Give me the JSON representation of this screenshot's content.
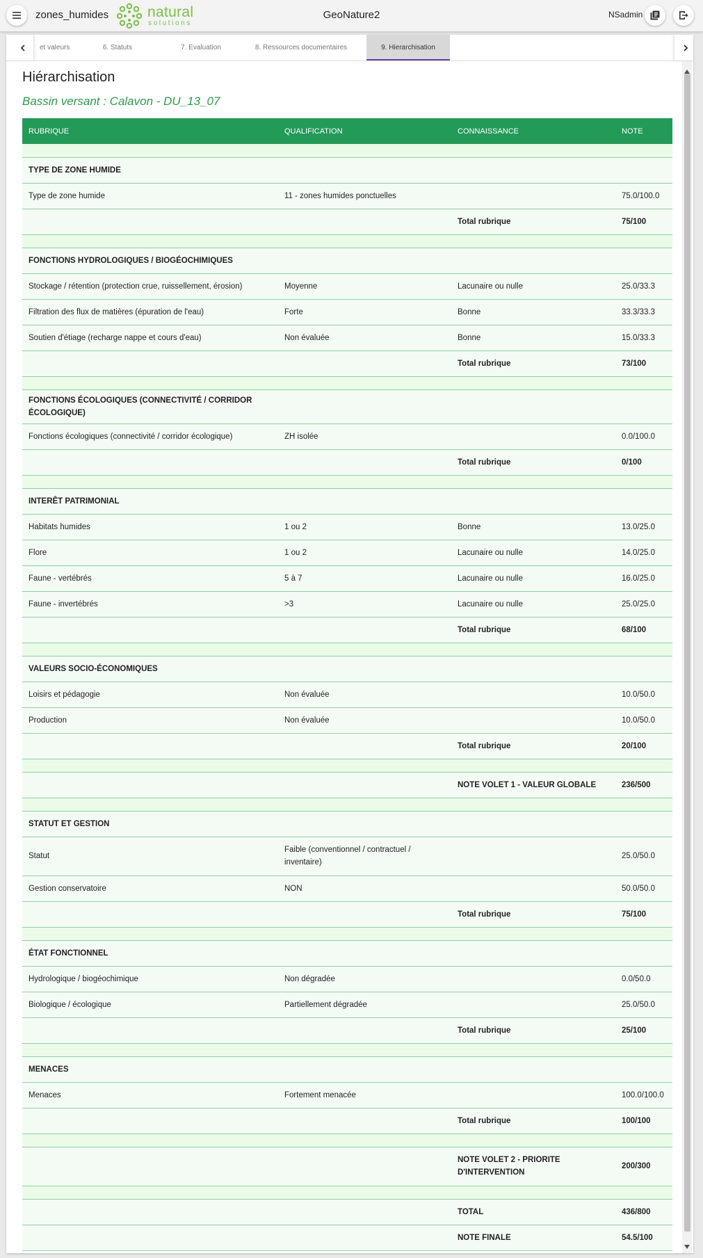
{
  "app": {
    "name": "zones_humides",
    "logo_word": "natural",
    "logo_sub": "solutions",
    "center_title": "GeoNature2",
    "user": "NSadmin"
  },
  "tabs": [
    {
      "label": "et valeurs",
      "active": false
    },
    {
      "label": "6. Statuts",
      "active": false
    },
    {
      "label": "7. Evaluation",
      "active": false
    },
    {
      "label": "8. Ressources documentaires",
      "active": false
    },
    {
      "label": "9. Hierarchisation",
      "active": true
    }
  ],
  "page": {
    "title": "Hiérarchisation",
    "subtitle": "Bassin versant : Calavon - DU_13_07"
  },
  "table": {
    "headers": [
      "RUBRIQUE",
      "QUALIFICATION",
      "CONNAISSANCE",
      "NOTE"
    ],
    "sections": [
      {
        "title": "TYPE DE ZONE HUMIDE",
        "rows": [
          {
            "rubrique": "Type de zone humide",
            "qualification": "11 - zones humides ponctuelles",
            "connaissance": "",
            "note": "75.0/100.0"
          }
        ],
        "total_label": "Total rubrique",
        "total": "75/100"
      },
      {
        "title": "FONCTIONS HYDROLOGIQUES / BIOGÉOCHIMIQUES",
        "rows": [
          {
            "rubrique": "Stockage / rétention (protection crue, ruissellement, érosion)",
            "qualification": "Moyenne",
            "connaissance": "Lacunaire ou nulle",
            "note": "25.0/33.3"
          },
          {
            "rubrique": "Filtration des flux de matières (épuration de l'eau)",
            "qualification": "Forte",
            "connaissance": "Bonne",
            "note": "33.3/33.3"
          },
          {
            "rubrique": "Soutien d'étiage (recharge nappe et cours d'eau)",
            "qualification": "Non évaluée",
            "connaissance": "Bonne",
            "note": "15.0/33.3"
          }
        ],
        "total_label": "Total rubrique",
        "total": "73/100"
      },
      {
        "title": "FONCTIONS ÉCOLOGIQUES (CONNECTIVITÉ / CORRIDOR ÉCOLOGIQUE)",
        "rows": [
          {
            "rubrique": "Fonctions écologiques (connectivité / corridor écologique)",
            "qualification": "ZH isolée",
            "connaissance": "",
            "note": "0.0/100.0"
          }
        ],
        "total_label": "Total rubrique",
        "total": "0/100"
      },
      {
        "title": "INTERÊT PATRIMONIAL",
        "rows": [
          {
            "rubrique": "Habitats humides",
            "qualification": "1 ou 2",
            "connaissance": "Bonne",
            "note": "13.0/25.0"
          },
          {
            "rubrique": "Flore",
            "qualification": "1 ou 2",
            "connaissance": "Lacunaire ou nulle",
            "note": "14.0/25.0"
          },
          {
            "rubrique": "Faune - vertébrés",
            "qualification": "5 à 7",
            "connaissance": "Lacunaire ou nulle",
            "note": "16.0/25.0"
          },
          {
            "rubrique": "Faune - invertébrés",
            "qualification": ">3",
            "connaissance": "Lacunaire ou nulle",
            "note": "25.0/25.0"
          }
        ],
        "total_label": "Total rubrique",
        "total": "68/100"
      },
      {
        "title": "VALEURS SOCIO-ÉCONOMIQUES",
        "rows": [
          {
            "rubrique": "Loisirs et pédagogie",
            "qualification": "Non évaluée",
            "connaissance": "",
            "note": "10.0/50.0"
          },
          {
            "rubrique": "Production",
            "qualification": "Non évaluée",
            "connaissance": "",
            "note": "10.0/50.0"
          }
        ],
        "total_label": "Total rubrique",
        "total": "20/100"
      }
    ],
    "volet1": {
      "label": "NOTE VOLET 1 - VALEUR GLOBALE",
      "value": "236/500"
    },
    "sections2": [
      {
        "title": "STATUT ET GESTION",
        "rows": [
          {
            "rubrique": "Statut",
            "qualification": "Faible (conventionnel / contractuel / inventaire)",
            "connaissance": "",
            "note": "25.0/50.0"
          },
          {
            "rubrique": "Gestion conservatoire",
            "qualification": "NON",
            "connaissance": "",
            "note": "50.0/50.0"
          }
        ],
        "total_label": "Total rubrique",
        "total": "75/100"
      },
      {
        "title": "ÉTAT FONCTIONNEL",
        "rows": [
          {
            "rubrique": "Hydrologique / biogéochimique",
            "qualification": "Non dégradée",
            "connaissance": "",
            "note": "0.0/50.0"
          },
          {
            "rubrique": "Biologique / écologique",
            "qualification": "Partiellement dégradée",
            "connaissance": "",
            "note": "25.0/50.0"
          }
        ],
        "total_label": "Total rubrique",
        "total": "25/100"
      },
      {
        "title": "MENACES",
        "rows": [
          {
            "rubrique": "Menaces",
            "qualification": "Fortement menacée",
            "connaissance": "",
            "note": "100.0/100.0"
          }
        ],
        "total_label": "Total rubrique",
        "total": "100/100"
      }
    ],
    "volet2": {
      "label": "NOTE VOLET 2 - PRIORITE D'INTERVENTION",
      "value": "200/300"
    },
    "total": {
      "label": "TOTAL",
      "value": "436/800"
    },
    "note_finale": {
      "label": "NOTE FINALE",
      "value": "54.5/100"
    }
  },
  "colors": {
    "header_green": "#239a57",
    "row_bg": "#f4fbf4",
    "spacer_bg": "#ebfbe8",
    "subtitle_green": "#2e9a4d",
    "active_tab_underline": "#6a3fa0"
  }
}
